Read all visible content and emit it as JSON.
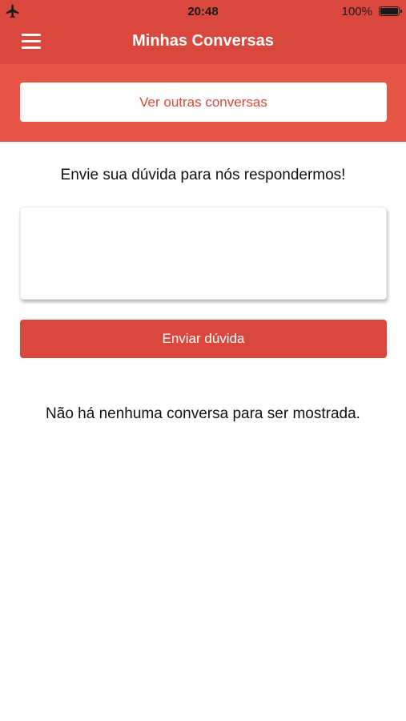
{
  "status_bar": {
    "time": "20:48",
    "battery_percent": "100%",
    "airplane_mode": true,
    "icons": [
      "airplane-icon",
      "battery-icon"
    ]
  },
  "nav": {
    "title": "Minhas Conversas",
    "menu_icon": "hamburger-menu-icon"
  },
  "subheader": {
    "other_conversations_label": "Ver outras conversas"
  },
  "main": {
    "prompt": "Envie sua dúvida para nós respondermos!",
    "question_input_value": "",
    "send_button_label": "Enviar dúvida",
    "empty_message": "Não há nenhuma conversa para ser mostrada."
  },
  "colors": {
    "header": "#d9473d",
    "subheader": "#e55444",
    "accent": "#d9473d",
    "background": "#ffffff"
  }
}
